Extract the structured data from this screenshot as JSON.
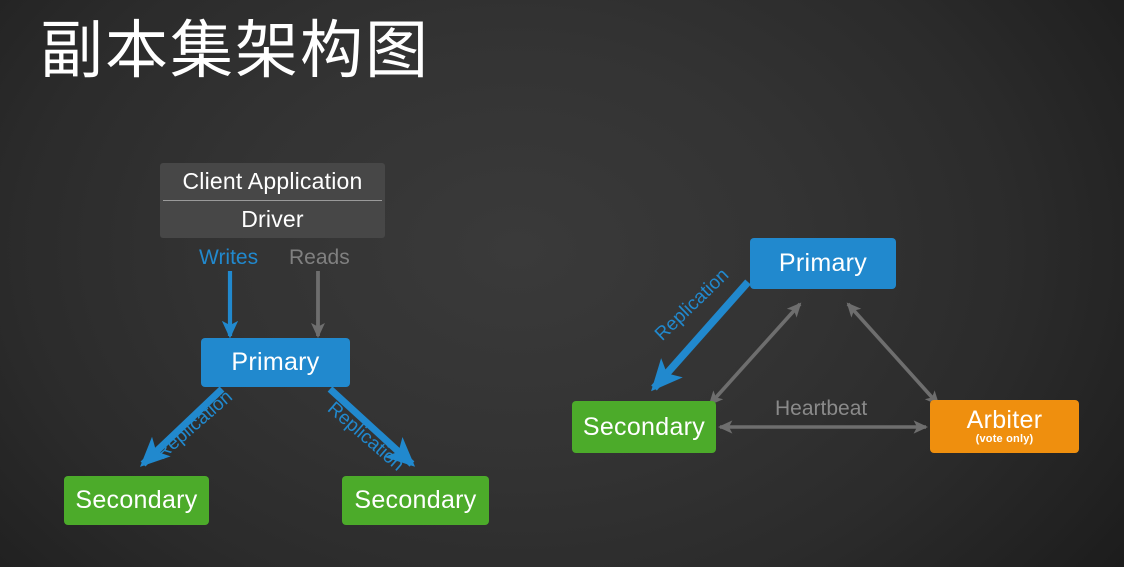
{
  "slide": {
    "title": "副本集架构图",
    "background_color": "#2f2f2f"
  },
  "colors": {
    "primary": "#2189ce",
    "secondary": "#4cab2a",
    "arbiter": "#ef8f0e",
    "client_box": "#474747",
    "gray_arrow": "#6e6e6e",
    "gray_text": "#808080",
    "text": "#ffffff"
  },
  "left_diagram": {
    "client_box": {
      "application_label": "Client Application",
      "driver_label": "Driver"
    },
    "flows": [
      {
        "label": "Writes",
        "color": "#2189ce"
      },
      {
        "label": "Reads",
        "color": "#808080"
      }
    ],
    "primary": {
      "label": "Primary"
    },
    "secondaries": [
      {
        "label": "Secondary"
      },
      {
        "label": "Secondary"
      }
    ],
    "replication_labels": [
      {
        "label": "Replication"
      },
      {
        "label": "Replication"
      }
    ]
  },
  "right_diagram": {
    "primary": {
      "label": "Primary"
    },
    "secondary": {
      "label": "Secondary"
    },
    "arbiter": {
      "label": "Arbiter",
      "sublabel": "(vote only)"
    },
    "replication_label": "Replication",
    "heartbeat_label": "Heartbeat"
  }
}
